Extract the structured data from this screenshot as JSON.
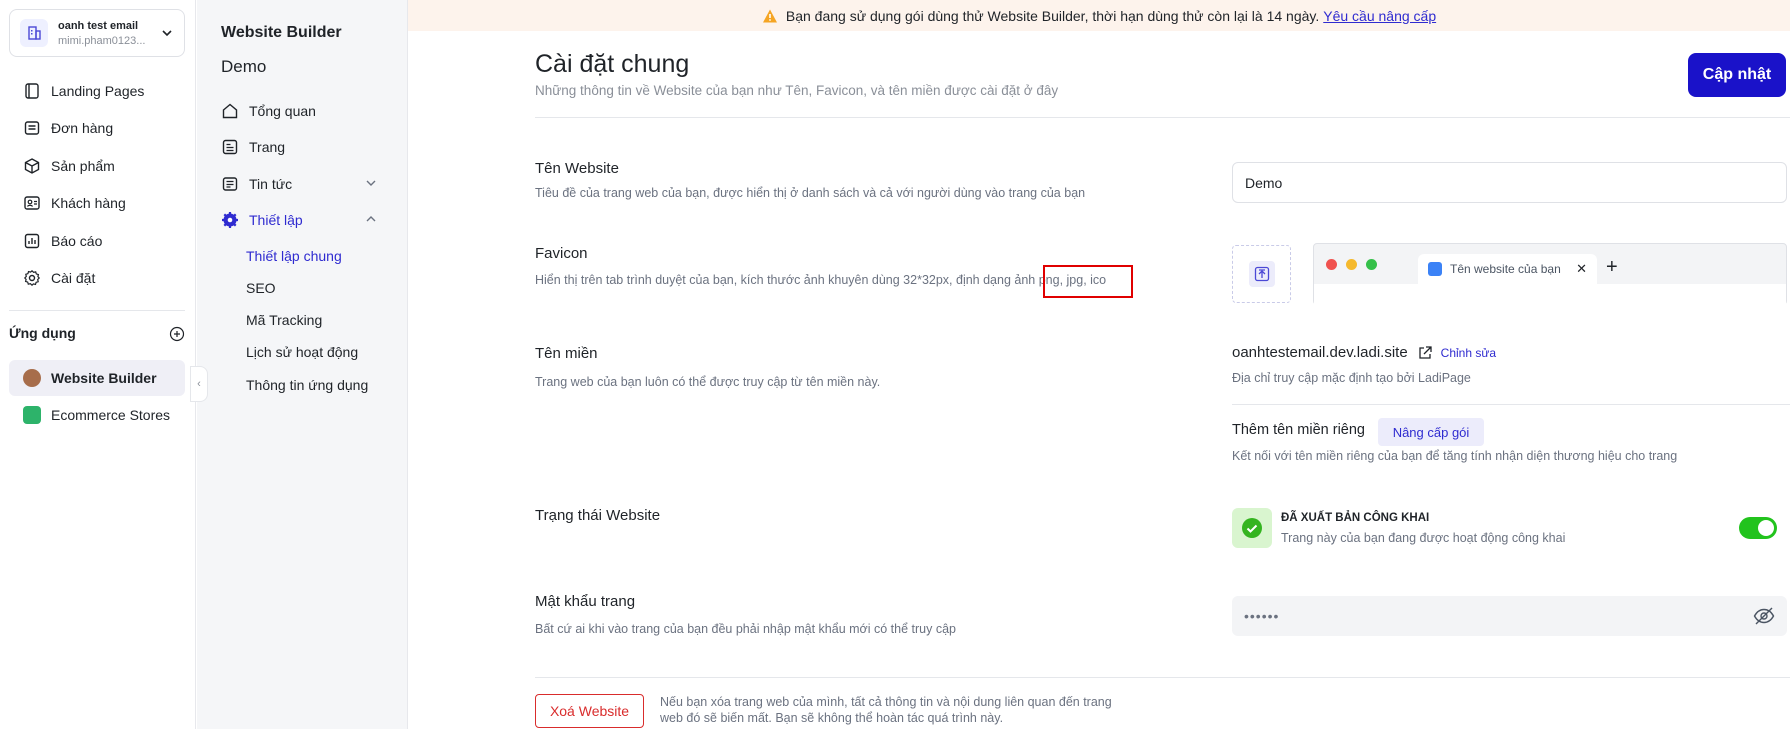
{
  "account": {
    "name": "oanh test email",
    "email": "mimi.pham0123..."
  },
  "nav": [
    {
      "label": "Landing Pages",
      "icon": "landing-pages-icon"
    },
    {
      "label": "Đơn hàng",
      "icon": "orders-icon"
    },
    {
      "label": "Sản phẩm",
      "icon": "products-icon"
    },
    {
      "label": "Khách hàng",
      "icon": "customers-icon"
    },
    {
      "label": "Báo cáo",
      "icon": "reports-icon"
    },
    {
      "label": "Cài đặt",
      "icon": "settings-icon"
    }
  ],
  "apps": {
    "title": "Ứng dụng",
    "items": [
      {
        "label": "Website Builder",
        "active": true
      },
      {
        "label": "Ecommerce Stores",
        "active": false
      }
    ]
  },
  "side2": {
    "title": "Website Builder",
    "subtitle": "Demo",
    "items": [
      {
        "label": "Tổng quan"
      },
      {
        "label": "Trang"
      },
      {
        "label": "Tin tức"
      },
      {
        "label": "Thiết lập"
      }
    ],
    "subitems": [
      {
        "label": "Thiết lập chung",
        "active": true
      },
      {
        "label": "SEO"
      },
      {
        "label": "Mã Tracking"
      },
      {
        "label": "Lịch sử hoạt động"
      },
      {
        "label": "Thông tin ứng dụng"
      }
    ]
  },
  "banner": {
    "text": "Bạn đang sử dụng gói dùng thử Website Builder, thời hạn dùng thử còn lại là 14 ngày.",
    "link": "Yêu cầu nâng cấp"
  },
  "page": {
    "title": "Cài đặt chung",
    "description": "Những thông tin về Website của bạn như Tên, Favicon, và tên miền được cài đặt ở đây",
    "update_button": "Cập nhật"
  },
  "website_name": {
    "title": "Tên Website",
    "description": "Tiêu đề của trang web của bạn, được hiển thị ở danh sách và cả với người dùng vào trang của bạn",
    "value": "Demo"
  },
  "favicon": {
    "title": "Favicon",
    "description": "Hiển thị trên tab trình duyệt của bạn, kích thước ảnh khuyên dùng 32*32px, định dạng ảnh png, jpg, ico",
    "tab_label": "Tên website của bạn"
  },
  "domain": {
    "title": "Tên miền",
    "description": "Trang web của bạn luôn có thể được truy cập từ tên miền này.",
    "value": "oanhtestemail.dev.ladi.site",
    "edit_label": "Chỉnh sửa",
    "value_desc": "Địa chỉ truy cập mặc định tạo bởi LadiPage",
    "custom_title": "Thêm tên miền riêng",
    "upgrade_label": "Nâng cấp gói",
    "custom_desc": "Kết nối với tên miền riêng của bạn để tăng tính nhận diện thương hiệu cho trang"
  },
  "status": {
    "title": "Trạng thái Website",
    "label": "ĐÃ XUẤT BẢN CÔNG KHAI",
    "description": "Trang này của bạn đang được hoạt động công khai",
    "enabled": true
  },
  "password": {
    "title": "Mật khẩu trang",
    "description": "Bất cứ ai khi vào trang của bạn đều phải nhập mật khẩu mới có thể truy cập",
    "value": "••••••"
  },
  "delete": {
    "button": "Xoá Website",
    "description": "Nếu bạn xóa trang web của mình, tất cả thông tin và nội dung liên quan đến trang web đó sẽ biến mất. Bạn sẽ không thể hoàn tác quá trình này."
  },
  "colors": {
    "primary": "#1a12c9",
    "link": "#2f2bd0",
    "danger": "#d92c2c",
    "success": "#22c31d"
  }
}
